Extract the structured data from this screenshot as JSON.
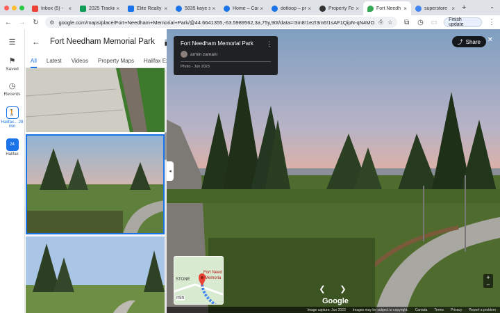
{
  "tabs": [
    {
      "label": "Inbox (5) - ",
      "color": "#ea4335"
    },
    {
      "label": "2025 Trackin",
      "color": "#0f9d58"
    },
    {
      "label": "Elite Realty",
      "color": "#1a73e8"
    },
    {
      "label": "5835 kaye st",
      "color": "#1a73e8"
    },
    {
      "label": "Home – Can",
      "color": "#1a73e8"
    },
    {
      "label": "dotloop – pr",
      "color": "#1a73e8"
    },
    {
      "label": "Property Fe",
      "color": "#333333"
    },
    {
      "label": "Fort Needh",
      "color": "#34a853"
    },
    {
      "label": "superstore",
      "color": "#4285f4"
    }
  ],
  "toolbar": {
    "url": "google.com/maps/place/Fort+Needham+Memorial+Park/@44.6641355,-63.5989562,3a,75y,90t/data=!3m8!1e2!3m6!1sAF1QipN-qN4MO",
    "finish_update": "Finish update"
  },
  "rail": {
    "saved": "Saved",
    "recents": "Recents",
    "recent1_label": "Halifax... 28 min",
    "recent2_label": "Halifax",
    "recent2_badge": "24"
  },
  "panel": {
    "title": "Fort Needham Memorial Park",
    "tabs": [
      "All",
      "Latest",
      "Videos",
      "Property Maps",
      "Halifax Ex"
    ]
  },
  "viewer": {
    "place_name": "Fort Needham Memorial Park",
    "author": "armin zamani",
    "photo_date": "Photo - Jun 2023",
    "share": "Share",
    "minimap_label1": "Fort Need",
    "minimap_label2": "Memoria",
    "minimap_stone": "STONE",
    "minimap_min": "min",
    "google": "Google",
    "footer": [
      "Image capture: Jun 2023",
      "Images may be subject to copyright.",
      "Canada",
      "Terms",
      "Privacy",
      "Report a problem"
    ]
  }
}
